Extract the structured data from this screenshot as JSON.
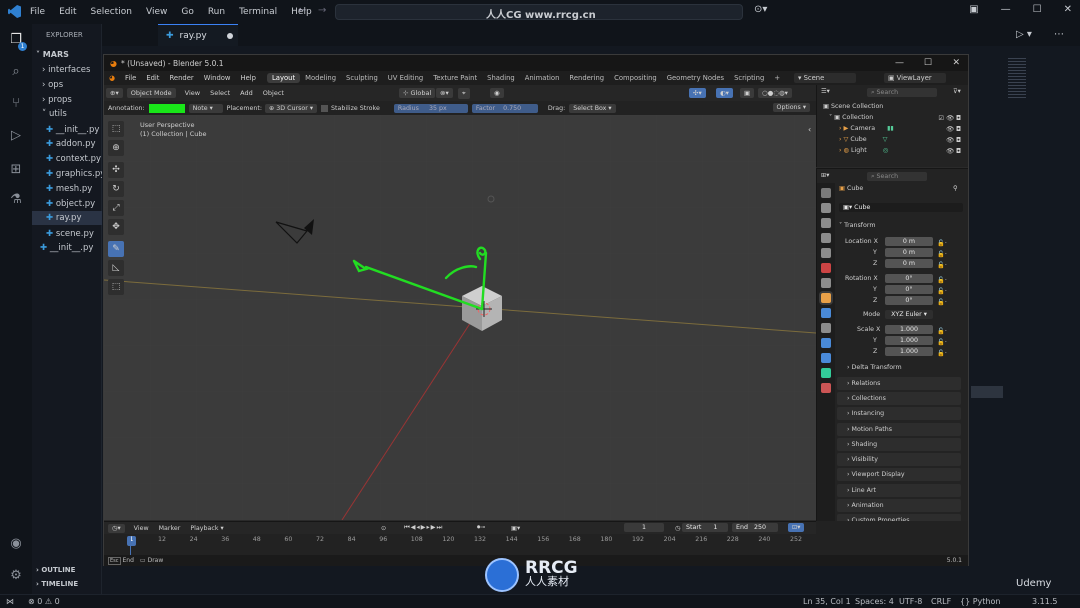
{
  "vscode": {
    "menu": [
      "File",
      "Edit",
      "Selection",
      "View",
      "Go",
      "Run",
      "Terminal",
      "Help"
    ],
    "explorer_title": "EXPLORER",
    "project": "MARS",
    "tree": [
      {
        "label": "interfaces",
        "kind": "folder"
      },
      {
        "label": "ops",
        "kind": "folder"
      },
      {
        "label": "props",
        "kind": "folder"
      },
      {
        "label": "utils",
        "kind": "folder-open"
      },
      {
        "label": "__init__.py",
        "kind": "file"
      },
      {
        "label": "addon.py",
        "kind": "file"
      },
      {
        "label": "context.py",
        "kind": "file"
      },
      {
        "label": "graphics.py",
        "kind": "file"
      },
      {
        "label": "mesh.py",
        "kind": "file"
      },
      {
        "label": "object.py",
        "kind": "file"
      },
      {
        "label": "ray.py",
        "kind": "file",
        "selected": true
      },
      {
        "label": "scene.py",
        "kind": "file"
      },
      {
        "label": "__init__.py",
        "kind": "file"
      }
    ],
    "outline": "OUTLINE",
    "timeline": "TIMELINE",
    "tab": "ray.py",
    "badge_count": "1",
    "status": {
      "errors": "0",
      "warnings": "0",
      "position": "Ln 35, Col 1",
      "spaces": "Spaces: 4",
      "encoding": "UTF-8",
      "eol": "CRLF",
      "language": "Python",
      "version": "3.11.5"
    },
    "watermark": "人人CG www.rrcg.cn"
  },
  "blender": {
    "title": "* (Unsaved) - Blender 5.0.1",
    "menus": [
      "File",
      "Edit",
      "Render",
      "Window",
      "Help"
    ],
    "workspaces": [
      "Layout",
      "Modeling",
      "Sculpting",
      "UV Editing",
      "Texture Paint",
      "Shading",
      "Animation",
      "Rendering",
      "Compositing",
      "Geometry Nodes",
      "Scripting"
    ],
    "active_workspace": "Layout",
    "scene": "Scene",
    "view_layer": "ViewLayer",
    "viewport_header": {
      "mode": "Object Mode",
      "menus": [
        "View",
        "Select",
        "Add",
        "Object"
      ],
      "orientation": "Global"
    },
    "tool_header": {
      "annotation_label": "Annotation:",
      "annotation_color": "#19e619",
      "note": "Note",
      "placement_label": "Placement:",
      "placement": "3D Cursor",
      "stabilize": "Stabilize Stroke",
      "radius_label": "Radius",
      "radius": "35 px",
      "factor_label": "Factor",
      "factor": "0.750",
      "drag_label": "Drag:",
      "drag": "Select Box",
      "options": "Options"
    },
    "viewport": {
      "perspective": "User Perspective",
      "collection": "(1) Collection | Cube"
    },
    "outliner": {
      "search": "Search",
      "root": "Scene Collection",
      "collection": "Collection",
      "items": [
        "Camera",
        "Cube",
        "Light"
      ]
    },
    "properties": {
      "search": "Search",
      "object": "Cube",
      "object_field": "Cube",
      "transform": "Transform",
      "location_label": "Location X",
      "location": [
        "0 m",
        "0 m",
        "0 m"
      ],
      "rotation_label": "Rotation X",
      "rotation": [
        "0°",
        "0°",
        "0°"
      ],
      "mode_label": "Mode",
      "mode": "XYZ Euler",
      "scale_label": "Scale X",
      "scale": [
        "1.000",
        "1.000",
        "1.000"
      ],
      "axis_y": "Y",
      "axis_z": "Z",
      "delta": "Delta Transform",
      "panels": [
        "Relations",
        "Collections",
        "Instancing",
        "Motion Paths",
        "Shading",
        "Visibility",
        "Viewport Display",
        "Line Art",
        "Animation",
        "Custom Properties"
      ]
    },
    "timeline": {
      "menus": [
        "View",
        "Marker",
        "Playback"
      ],
      "current_frame": "1",
      "start_label": "Start",
      "start": "1",
      "end_label": "End",
      "end": "250",
      "ticks": [
        "12",
        "24",
        "36",
        "48",
        "60",
        "72",
        "84",
        "96",
        "108",
        "120",
        "132",
        "144",
        "156",
        "168",
        "180",
        "192",
        "204",
        "216",
        "228",
        "240",
        "252"
      ],
      "current_tick": "1"
    },
    "status_bar": {
      "end": "End",
      "draw": "Draw",
      "version": "5.0.1"
    }
  },
  "overlay": {
    "logo_text": "RRCG",
    "logo_sub": "人人素材",
    "udemy": "Udemy"
  }
}
